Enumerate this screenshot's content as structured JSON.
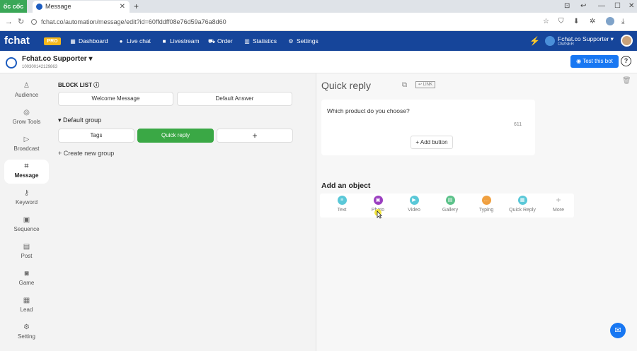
{
  "browser": {
    "brand": "ốc cốc",
    "tab_title": "Message",
    "url": "fchat.co/automation/message/edit?id=60ffddff08e76d59a76a8d60"
  },
  "appnav": {
    "logo": "fchat",
    "badge": "PRO",
    "items": [
      {
        "label": "Dashboard",
        "icon": "dashboard-icon"
      },
      {
        "label": "Live chat",
        "icon": "chat-icon"
      },
      {
        "label": "Livestream",
        "icon": "video-icon"
      },
      {
        "label": "Order",
        "icon": "cart-icon"
      },
      {
        "label": "Statistics",
        "icon": "bar-chart-icon"
      },
      {
        "label": "Settings",
        "icon": "gear-icon"
      }
    ],
    "user": {
      "name": "Fchat.co Supporter ▾",
      "role": "OWNER"
    }
  },
  "header": {
    "bot_name": "Fchat.co Supporter",
    "bot_id": "100300142129863",
    "test_button": "Test this bot",
    "help": "?"
  },
  "sidebar": {
    "items": [
      {
        "label": "Audience",
        "icon": "audience-icon"
      },
      {
        "label": "Grow Tools",
        "icon": "grow-tools-icon"
      },
      {
        "label": "Broadcast",
        "icon": "broadcast-icon"
      },
      {
        "label": "Message",
        "icon": "message-icon",
        "active": true
      },
      {
        "label": "Keyword",
        "icon": "keyword-icon"
      },
      {
        "label": "Sequence",
        "icon": "sequence-icon"
      },
      {
        "label": "Post",
        "icon": "post-icon"
      },
      {
        "label": "Game",
        "icon": "game-icon"
      },
      {
        "label": "Lead",
        "icon": "lead-icon"
      },
      {
        "label": "Setting",
        "icon": "setting-icon"
      }
    ]
  },
  "blocks": {
    "title": "BLOCK LIST",
    "welcome": "Welcome Message",
    "default_answer": "Default Answer",
    "group_label": "Default group",
    "group_items": [
      "Tags",
      "Quick reply",
      "+"
    ],
    "create_group": "+ Create new group"
  },
  "editor": {
    "title": "Quick reply",
    "link_badge": "LINK",
    "message_text": "Which product do you choose?",
    "char_count": "611",
    "add_button": "+ Add button",
    "add_object_title": "Add an object",
    "objects": [
      {
        "label": "Text",
        "color": "#5ac8d8"
      },
      {
        "label": "Photo",
        "color": "#9b3fc0"
      },
      {
        "label": "Video",
        "color": "#5ac8d8"
      },
      {
        "label": "Gallery",
        "color": "#5cc28a"
      },
      {
        "label": "Typing",
        "color": "#f0a040"
      },
      {
        "label": "Quick Reply",
        "color": "#5ac8d8"
      },
      {
        "label": "More",
        "color": ""
      }
    ]
  },
  "colors": {
    "nav_bg": "#16459a",
    "accent_green": "#3aa845",
    "test_btn": "#1877f2"
  }
}
